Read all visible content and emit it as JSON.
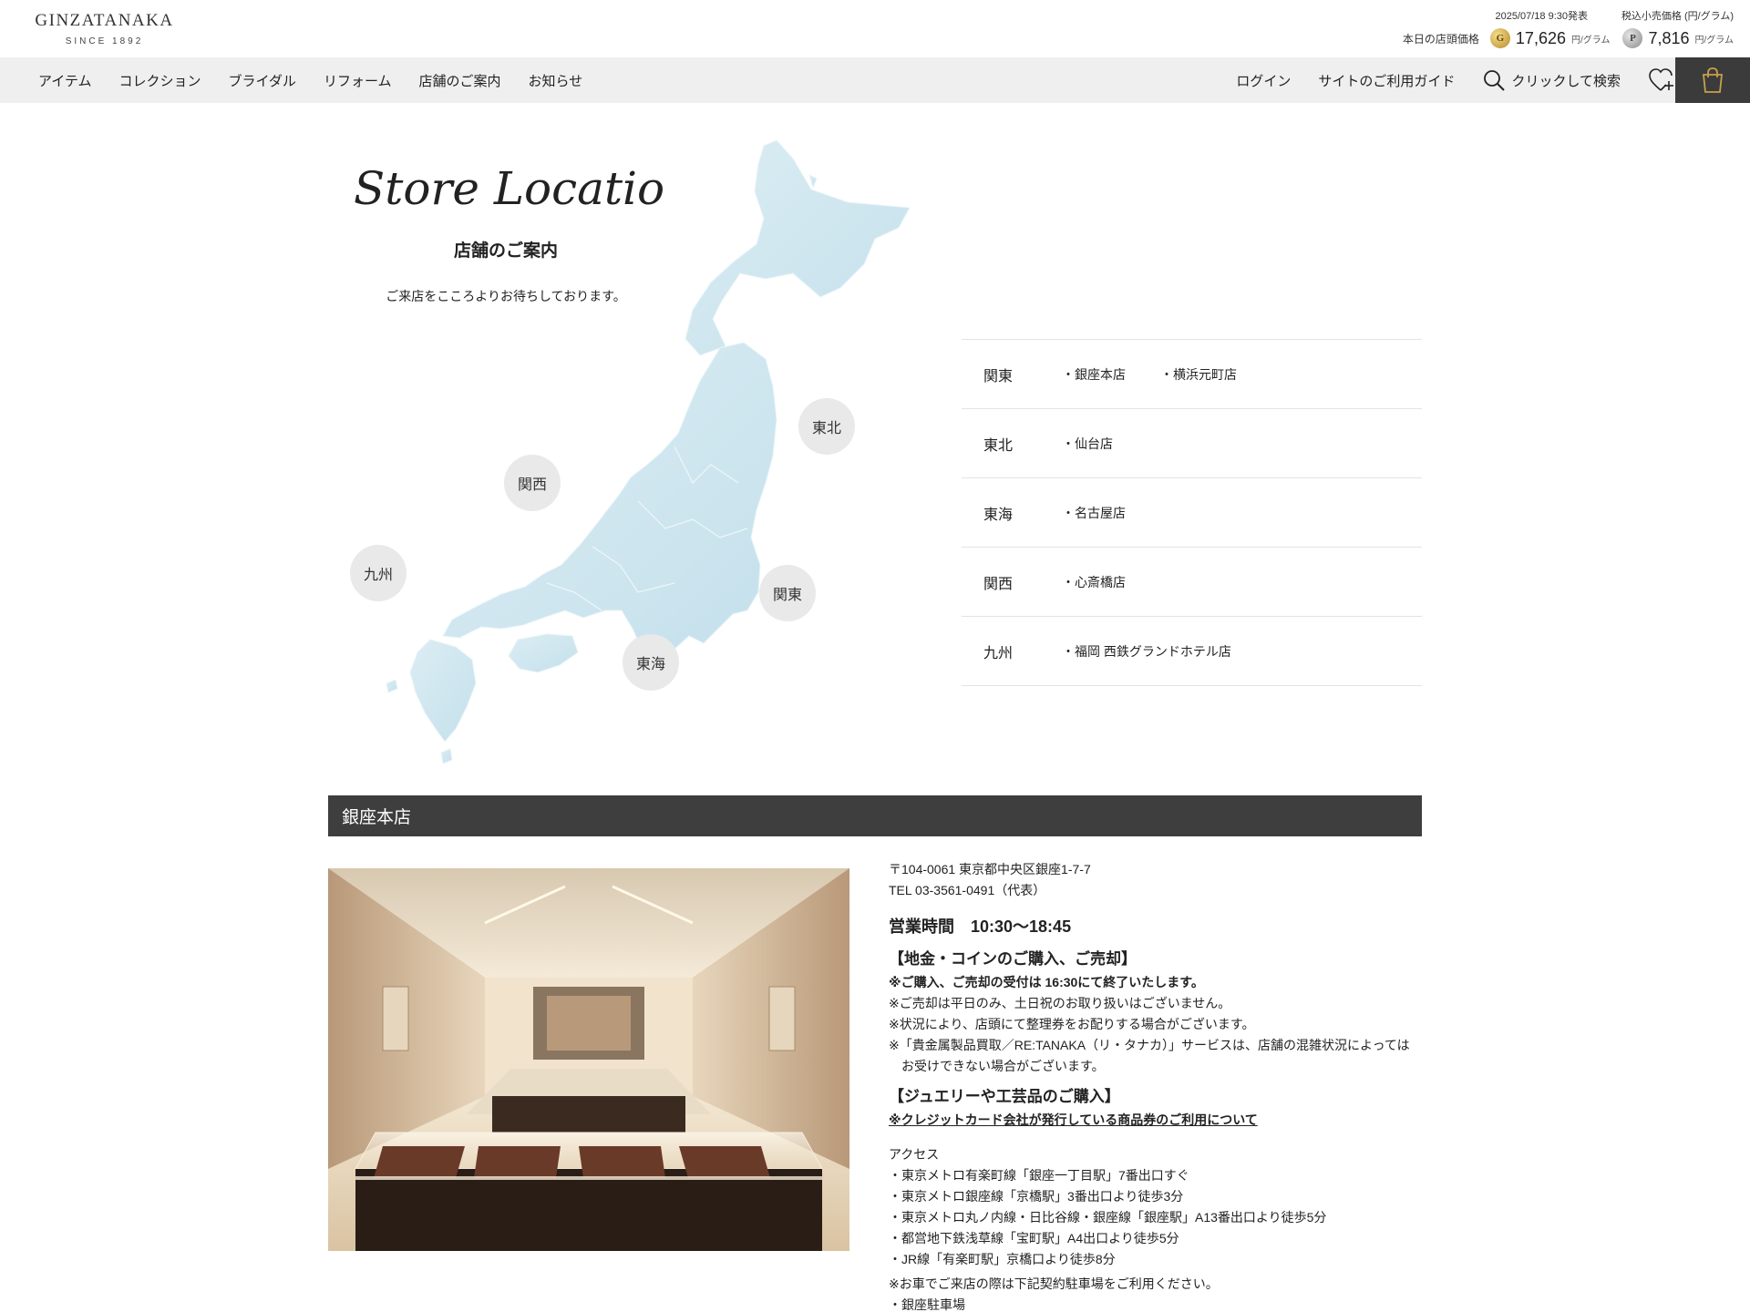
{
  "header": {
    "logo_main": "GINZATANAKA",
    "logo_sub": "SINCE 1892",
    "price_date": "2025/07/18 9:30発表",
    "price_note": "税込小売価格 (円/グラム)",
    "price_label": "本日の店頭価格",
    "gold_symbol": "G",
    "gold_price": "17,626",
    "gold_unit": "円/グラム",
    "plat_symbol": "P",
    "plat_price": "7,816",
    "plat_unit": "円/グラム"
  },
  "nav": {
    "left": [
      "アイテム",
      "コレクション",
      "ブライダル",
      "リフォーム",
      "店舗のご案内",
      "お知らせ"
    ],
    "login": "ログイン",
    "guide": "サイトのご利用ガイド",
    "search": "クリックして検索",
    "icons": {
      "search": "search-icon",
      "wishlist": "heart-plus-icon",
      "cart": "shopping-bag-icon"
    }
  },
  "hero": {
    "script_title": "Store Location",
    "title": "店舗のご案内",
    "subtitle": "ご来店をこころよりお待ちしております。"
  },
  "map_bubbles": {
    "tohoku": "東北",
    "kansai": "関西",
    "kyushu": "九州",
    "kanto": "関東",
    "tokai": "東海"
  },
  "regions": [
    {
      "name": "関東",
      "stores": [
        "・銀座本店",
        "・横浜元町店"
      ]
    },
    {
      "name": "東北",
      "stores": [
        "・仙台店"
      ]
    },
    {
      "name": "東海",
      "stores": [
        "・名古屋店"
      ]
    },
    {
      "name": "関西",
      "stores": [
        "・心斎橋店"
      ]
    },
    {
      "name": "九州",
      "stores": [
        "・福岡 西鉄グランドホテル店"
      ]
    }
  ],
  "store": {
    "name": "銀座本店",
    "address": "〒104-0061 東京都中央区銀座1-7-7",
    "tel": "TEL 03-3561-0491（代表）",
    "hours": "営業時間　10:30〜18:45",
    "bullion_head": "【地金・コインのご購入、ご売却】",
    "bullion_notes": [
      "※ご購入、ご売却の受付は 16:30にて終了いたします。",
      "※ご売却は平日のみ、土日祝のお取り扱いはございません。",
      "※状況により、店頭にて整理券をお配りする場合がございます。",
      "※「貴金属製品買取／RE:TANAKA（リ・タナカ）」サービスは、店舗の混雑状況によってはお受けできない場合がございます。"
    ],
    "jewelry_head": "【ジュエリーや工芸品のご購入】",
    "jewelry_link": "※クレジットカード会社が発行している商品券のご利用について",
    "access_head": "アクセス",
    "access": [
      "・東京メトロ有楽町線「銀座一丁目駅」7番出口すぐ",
      "・東京メトロ銀座線「京橋駅」3番出口より徒歩3分",
      "・東京メトロ丸ノ内線・日比谷線・銀座線「銀座駅」A13番出口より徒歩5分",
      "・都営地下鉄浅草線「宝町駅」A4出口より徒歩5分",
      "・JR線「有楽町駅」京橋口より徒歩8分"
    ],
    "parking_note": "※お車でご来店の際は下記契約駐車場をご利用ください。",
    "parking_first": "・銀座駐車場"
  },
  "colors": {
    "nav_bg": "#efefef",
    "cart_bg": "#3b3b3b",
    "section_header_bg": "#3e3e3e",
    "map_blue": "#cfe6ef",
    "bubble_bg": "#e9e9e9"
  }
}
